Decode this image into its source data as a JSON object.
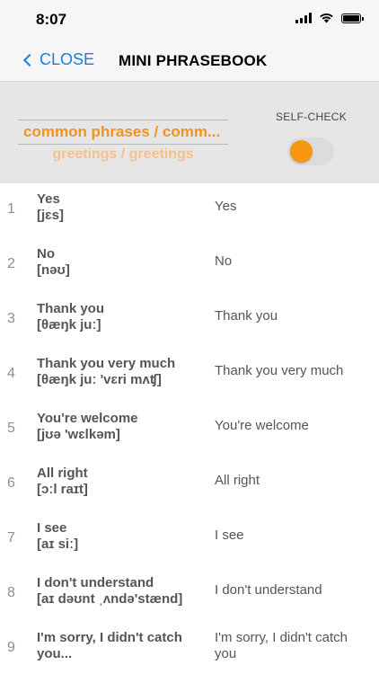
{
  "status": {
    "time": "8:07"
  },
  "nav": {
    "close_label": "CLOSE",
    "title": "MINI PHRASEBOOK"
  },
  "picker": {
    "selected": "common phrases / comm...",
    "next": "greetings / greetings",
    "next2": "... / ..."
  },
  "self_check": {
    "label": "SELF-CHECK",
    "enabled": false
  },
  "colors": {
    "accent": "#f3931f",
    "link": "#1a7fe0",
    "panel": "#e6e6e6"
  },
  "phrases": [
    {
      "num": "1",
      "phrase": "Yes",
      "transcription": "[jɛs]",
      "translation": "Yes"
    },
    {
      "num": "2",
      "phrase": "No",
      "transcription": "[nəʊ]",
      "translation": "No"
    },
    {
      "num": "3",
      "phrase": "Thank you",
      "transcription": "[θæŋk juː]",
      "translation": "Thank you"
    },
    {
      "num": "4",
      "phrase": "Thank you very much",
      "transcription": "[θæŋk juː 'vɛri mʌʧ]",
      "translation": "Thank you very much"
    },
    {
      "num": "5",
      "phrase": "You're welcome",
      "transcription": "[jʊə 'wɛlkəm]",
      "translation": "You're welcome"
    },
    {
      "num": "6",
      "phrase": "All right",
      "transcription": "[ɔːl raɪt]",
      "translation": "All right"
    },
    {
      "num": "7",
      "phrase": "I see",
      "transcription": "[aɪ siː]",
      "translation": "I see"
    },
    {
      "num": "8",
      "phrase": "I don't understand",
      "transcription": "[aɪ dəʊnt ˌʌndə'stænd]",
      "translation": "I don't understand"
    },
    {
      "num": "9",
      "phrase": "I'm sorry, I didn't catch you...",
      "transcription": "",
      "translation": "I'm sorry, I didn't catch you"
    }
  ]
}
